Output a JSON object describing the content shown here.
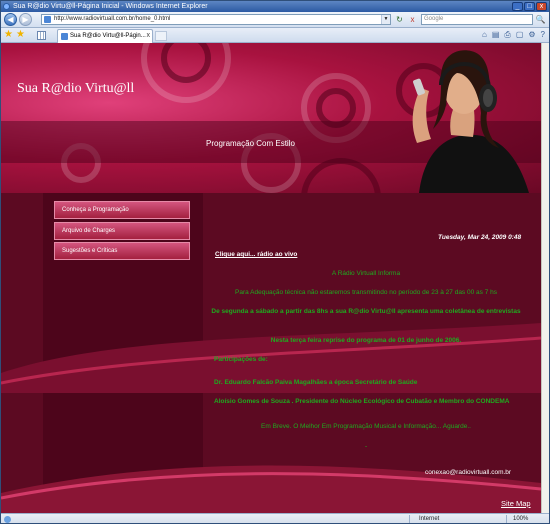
{
  "window": {
    "title": "Sua R@dio Virtu@ll-Página Inicial - Windows Internet Explorer",
    "min": "_",
    "max": "□",
    "close": "x"
  },
  "nav": {
    "back": "◀",
    "forward": "▶",
    "url": "http://www.radiovirtuall.com.br/home_0.html",
    "search_placeholder": "Google",
    "refresh": "↻",
    "stop": "x",
    "search_go": "🔍"
  },
  "tabs": {
    "active": "Sua R@dio Virtu@ll-Págin...",
    "close": "x"
  },
  "commands": {
    "home": "⌂",
    "feeds": "▤",
    "print": "⎙",
    "page": "▢",
    "tools": "⚙",
    "help": "?"
  },
  "page": {
    "logo": "Sua R@dio Virtu@ll",
    "tagline": "Programação Com Estilo",
    "menu": [
      {
        "label": "Conheça a Programação"
      },
      {
        "label": "Arquivo de Charges"
      },
      {
        "label": "Sugestões e Críticas"
      }
    ],
    "date": "Tuesday, Mar 24, 2009 0:48",
    "radio_link": "Clique aqui... rádio ao vivo",
    "content": [
      "A Rádio Virtuall Informa",
      "Para Adequação técnica não estaremos transmitindo no período de  23 à 27  das 00 as 7 hs",
      "De segunda a sábado a partir das 8hs a sua R@dio Virtu@ll apresenta uma coletânea de entrevistas",
      "Nesta terça feira reprise do programa de 01 de junho  de 2006.",
      "Participações de:",
      "Dr. Eduardo Falcão Paiva Magalhães a época Secretário de Saúde",
      "Aloísio Gomes de Souza . Presidente do Núcleo Ecológico de Cubatão e Membro do CONDEMA",
      "Em Breve.  O Melhor Em Programação Musical e Informação... Aguarde..",
      "."
    ],
    "email": "conexao@radiovirtuall.com.br",
    "sitemap": "Site Map"
  },
  "status": {
    "zone": "Internet",
    "zoom": "100%"
  }
}
